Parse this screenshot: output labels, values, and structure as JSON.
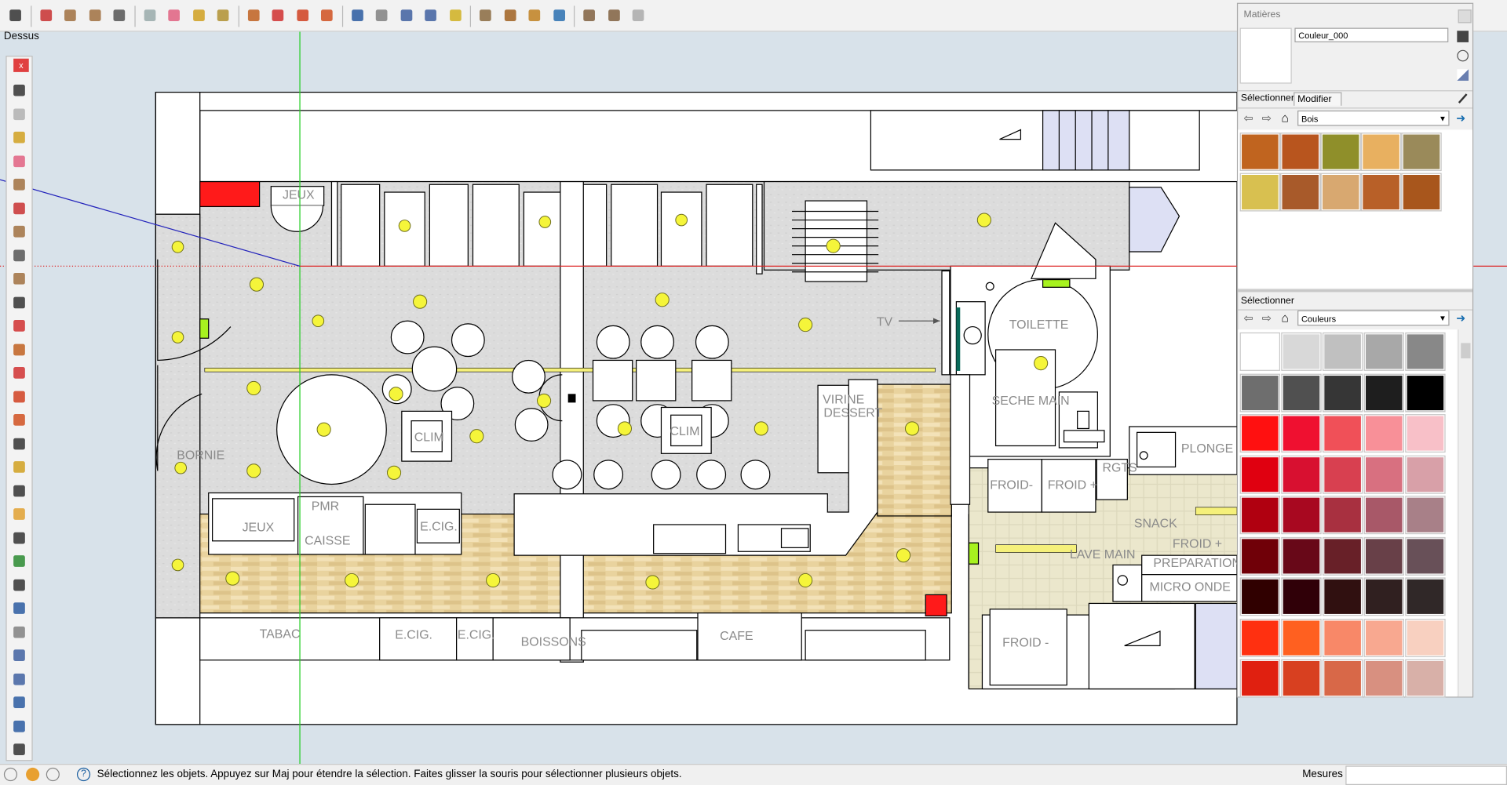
{
  "view_label": "Dessus",
  "toolbar": {
    "icons": [
      "select-icon",
      "pencil-icon",
      "rectangle-icon",
      "circle-icon",
      "arc-icon",
      "eraser-icon",
      "eraser2-icon",
      "paint-icon",
      "paint2-icon",
      "pushpull-icon",
      "move-icon",
      "rotate-icon",
      "followme-icon",
      "orbit-icon",
      "pan-icon",
      "zoom-icon",
      "zoom-extents-icon",
      "section-icon",
      "scenes-icon",
      "component-icon",
      "import-icon",
      "globe-icon",
      "warehouse-icon",
      "extension-icon",
      "styles-icon"
    ]
  },
  "plan_labels": {
    "jeux_top": "JEUX",
    "borne": "BORNIE",
    "clim1": "CLIM",
    "clim2": "CLIM",
    "jeux_bottom": "JEUX",
    "pmr": "PMR",
    "caisse": "CAISSE",
    "ecig1": "E.CIG.",
    "tabac": "TABAC",
    "ecig2": "E.CIG.",
    "ecig3": "E.CIG.",
    "boissons": "BOISSONS",
    "cafe": "CAFE",
    "vitrine": "VIRINE",
    "dessert": "DESSERT",
    "tv": "TV",
    "toilette": "TOILETTE",
    "seche_main": "SECHE MAIN",
    "froid_minus1": "FROID-",
    "froid_plus1": "FROID +",
    "rgts": "RGTS",
    "plonge": "PLONGE",
    "snack": "SNACK",
    "froid_plus2": "FROID +",
    "lave_main": "LAVE MAIN",
    "preparation": "PREPARATION",
    "micro_onde": "MICRO ONDE",
    "froid_minus2": "FROID -"
  },
  "materials_panel": {
    "title": "Matières",
    "material_name": "Couleur_000",
    "tab_select": "Sélectionner",
    "tab_modify": "Modifier",
    "library1": "Bois",
    "section2_label": "Sélectionner",
    "library2": "Couleurs",
    "wood_swatches": [
      "#c0641f",
      "#b8551e",
      "#8f8f2a",
      "#e8b060",
      "#9a8a5a",
      "#d8c050",
      "#a85a2a",
      "#d8a870",
      "#b86028",
      "#a8561c"
    ],
    "color_swatches": [
      "#ffffff",
      "#d8d8d8",
      "#c0c0c0",
      "#a8a8a8",
      "#888888",
      "#6e6e6e",
      "#505050",
      "#363636",
      "#1e1e1e",
      "#000000",
      "#ff1010",
      "#ef1030",
      "#f05058",
      "#f89098",
      "#f8c0c8",
      "#e00010",
      "#d81030",
      "#d84050",
      "#d87080",
      "#d8a0a8",
      "#b00010",
      "#a80820",
      "#a83040",
      "#a85868",
      "#a88088",
      "#700008",
      "#680818",
      "#682028",
      "#684048",
      "#685058",
      "#300000",
      "#300008",
      "#301010",
      "#302020",
      "#302828",
      "#ff3010",
      "#ff6020",
      "#f88868",
      "#f8a890",
      "#f8d0c0",
      "#e02010",
      "#d84020",
      "#d86848",
      "#d89080",
      "#d8b0a8"
    ]
  },
  "status": {
    "message": "Sélectionnez les objets. Appuyez sur Maj pour étendre la sélection. Faites glisser la souris pour sélectionner plusieurs objets.",
    "measures_label": "Mesures",
    "measures_value": ""
  }
}
